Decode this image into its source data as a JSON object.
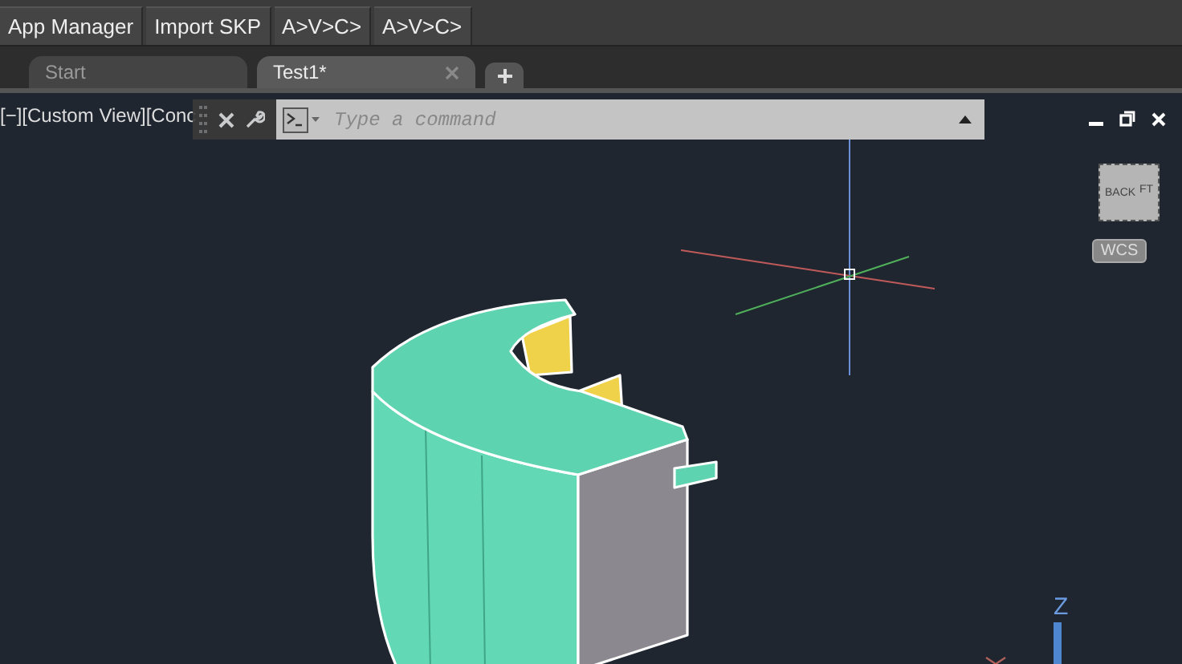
{
  "ribbon": {
    "buttons": [
      "App Manager",
      "Import SKP",
      "A>V>C>",
      "A>V>C>"
    ]
  },
  "file_tabs": [
    {
      "label": "Start",
      "selected": false,
      "closable": false
    },
    {
      "label": "Test1*",
      "selected": true,
      "closable": true
    }
  ],
  "viewport": {
    "label": "[−][Custom View][Conc",
    "viewcube": {
      "faces": [
        "BACK",
        "FT"
      ],
      "wcs": "WCS"
    },
    "ucs": {
      "z_label": "Z"
    }
  },
  "command_line": {
    "placeholder": "Type a command"
  }
}
